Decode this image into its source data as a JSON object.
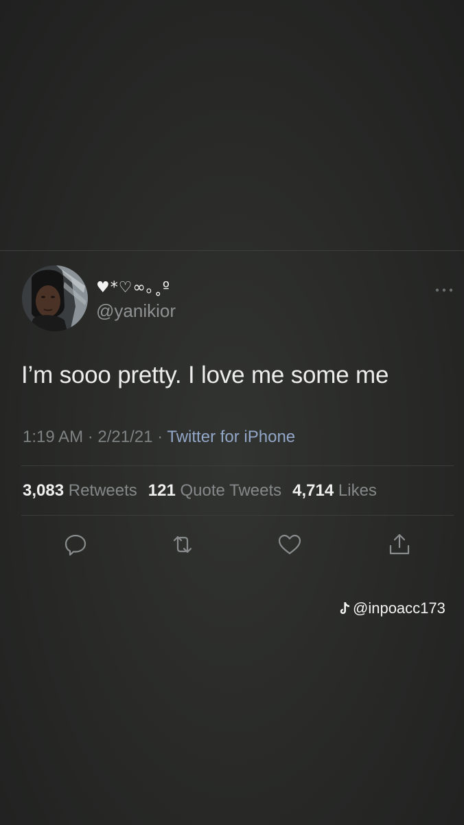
{
  "tweet": {
    "display_name": "♥*♡∞｡˳º",
    "handle": "@yanikior",
    "text": "I’m sooo pretty. I love me some me",
    "time": "1:19 AM",
    "separator": "·",
    "date": "2/21/21",
    "source": "Twitter for iPhone",
    "stats": {
      "retweets_count": "3,083",
      "retweets_label": "Retweets",
      "quotes_count": "121",
      "quotes_label": "Quote Tweets",
      "likes_count": "4,714",
      "likes_label": "Likes"
    },
    "actions": [
      {
        "icon": "reply-icon"
      },
      {
        "icon": "retweet-icon"
      },
      {
        "icon": "like-icon"
      },
      {
        "icon": "share-icon"
      }
    ],
    "menu_icon": "more-icon"
  },
  "watermark": {
    "icon": "tiktok-icon",
    "text": "@inpoacc173"
  },
  "colors": {
    "background": "#2a2b29",
    "text_primary": "#ededed",
    "text_secondary": "#7e8283",
    "link": "#93a7c8"
  }
}
